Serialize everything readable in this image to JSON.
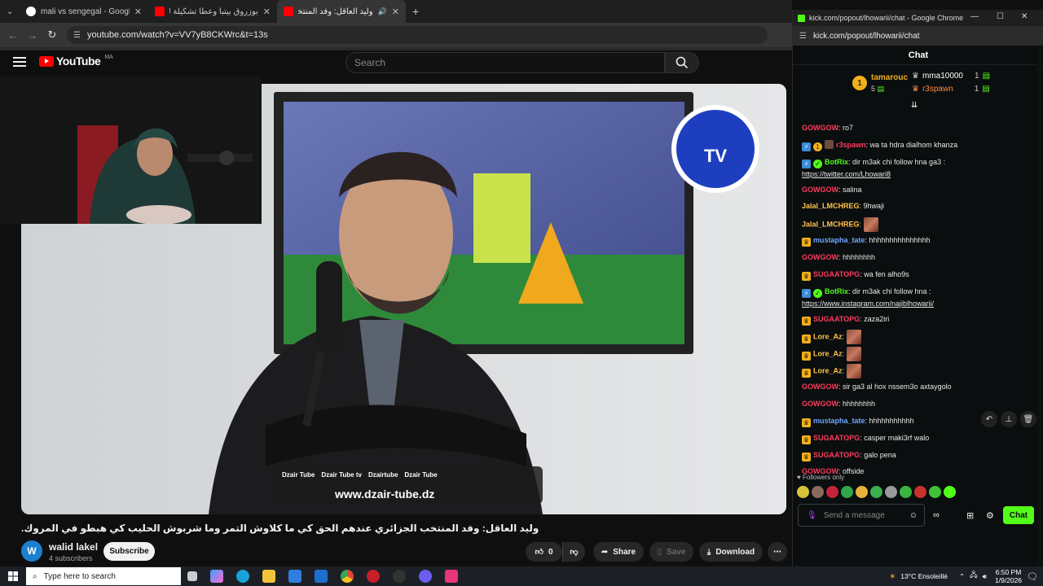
{
  "browser": {
    "tabs": [
      {
        "title": "mali vs sengegal - Google Search",
        "fav_color": "#ffffff"
      },
      {
        "title": "بوزروق بيتبأ وعطا تشكيلة لركراكي",
        "fav_color": "#ff0000"
      },
      {
        "title": "وليد العاقل: وفد المنتخب الج",
        "fav_color": "#ff0000"
      }
    ],
    "url": "youtube.com/watch?v=VV7yB8CKWrc&t=13s"
  },
  "youtube": {
    "logo_text": "YouTube",
    "region": "MA",
    "search_placeholder": "Search",
    "caption": "وليد العاقل: وفد المنتخب الجزائري عندهم الحق كي ما كلاوش التمر وما شربوش الحليب كي هبطو في المروك.",
    "channel": {
      "avatar_letter": "W",
      "name": "walid lakel",
      "subscribers": "4 subscribers"
    },
    "subscribe_label": "Subscribe",
    "likes": "0",
    "share_label": "Share",
    "save_label": "Save",
    "download_label": "Download",
    "video_overlay": {
      "social_items": [
        "Dzair Tube",
        "Dzair Tube tv",
        "Dzairtube",
        "Dzair Tube"
      ],
      "website": "www.dzair-tube.dz",
      "logo_text": "TV"
    }
  },
  "chat_window": {
    "title": "kick.com/popout/lhowarii/chat - Google Chrome",
    "url": "kick.com/popout/lhowarii/chat",
    "header": "Chat",
    "leaderboard": {
      "top": {
        "rank": "1",
        "name": "tamarouc",
        "count": "5"
      },
      "others": [
        {
          "name": "mma10000",
          "count": "1"
        },
        {
          "name": "r3spawn",
          "count": "1"
        }
      ]
    },
    "messages": [
      {
        "user": "GOWGOW",
        "color": "#ff3b5c",
        "text": "ro7",
        "badge": ""
      },
      {
        "user": "r3spawn",
        "color": "#ff3b5c",
        "text": "wa ta hdra dialhom khanza",
        "badge": "multi"
      },
      {
        "user": "BotRix",
        "color": "#53fc18",
        "text": "dir m3ak chi follow hna ga3 :",
        "link": "https://twitter.com/Lhowari8",
        "badge": "bot"
      },
      {
        "user": "GOWGOW",
        "color": "#ff3b5c",
        "text": "salina",
        "badge": ""
      },
      {
        "user": "Jalal_LMCHREG",
        "color": "#ffc24b",
        "text": "9hwaji",
        "badge": ""
      },
      {
        "user": "Jalal_LMCHREG",
        "color": "#ffc24b",
        "text": "",
        "emote": true,
        "badge": ""
      },
      {
        "user": "mustapha_tate",
        "color": "#6fa8ff",
        "text": "hhhhhhhhhhhhhhh",
        "badge": "crown"
      },
      {
        "user": "GOWGOW",
        "color": "#ff3b5c",
        "text": "hhhhhhhh",
        "badge": ""
      },
      {
        "user": "SUGAATOPG",
        "color": "#ff3b5c",
        "text": "wa fen alho9s",
        "badge": "crown"
      },
      {
        "user": "BotRix",
        "color": "#53fc18",
        "text": "dir m3ak chi follow hna :",
        "link": "https://www.instagram.com/najiblhowarii/",
        "badge": "bot"
      },
      {
        "user": "SUGAATOPG",
        "color": "#ff3b5c",
        "text": "zaza2iri",
        "badge": "crown"
      },
      {
        "user": "Lore_Az",
        "color": "#ffc24b",
        "text": "",
        "emote": true,
        "badge": "crown"
      },
      {
        "user": "Lore_Az",
        "color": "#ffc24b",
        "text": "",
        "emote": true,
        "badge": "crown"
      },
      {
        "user": "Lore_Az",
        "color": "#ffc24b",
        "text": "",
        "emote": true,
        "badge": "crown"
      },
      {
        "user": "GOWGOW",
        "color": "#ff3b5c",
        "text": "sir ga3 al hox nssem3o axtaygolo",
        "badge": ""
      },
      {
        "user": "GOWGOW",
        "color": "#ff3b5c",
        "text": "hhhhhhhh",
        "badge": ""
      },
      {
        "user": "mustapha_tate",
        "color": "#6fa8ff",
        "text": "hhhhhhhhhhh",
        "badge": "crown"
      },
      {
        "user": "SUGAATOPG",
        "color": "#ff3b5c",
        "text": "casper maki3rf walo",
        "badge": "crown"
      },
      {
        "user": "SUGAATOPG",
        "color": "#ff3b5c",
        "text": "galo pena",
        "badge": "crown"
      },
      {
        "user": "GOWGOW",
        "color": "#ff3b5c",
        "text": "offside",
        "badge": ""
      }
    ],
    "followers_only": "Followers only",
    "input_placeholder": "Send a message",
    "send_label": "Chat",
    "accent": "#53fc18"
  },
  "taskbar": {
    "search_placeholder": "Type here to search",
    "weather": "13°C  Ensoleillé",
    "time": "6:50 PM",
    "date": "1/9/2026"
  }
}
